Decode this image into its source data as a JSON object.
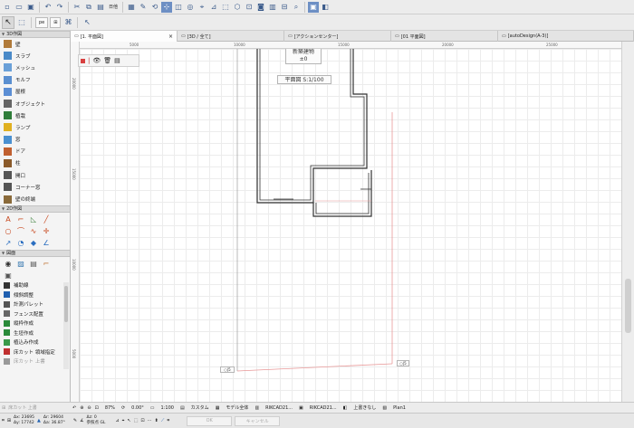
{
  "toolbar1": {
    "text_label": "日他",
    "icons": [
      "open-icon",
      "save-icon",
      "print-icon",
      "undo-icon",
      "redo-icon",
      "cut-icon",
      "copy-icon",
      "paste-icon"
    ]
  },
  "toolbar2": {
    "pen_dropdown": "pe",
    "layer_dropdown": "⊞",
    "arrow_tool": "↖"
  },
  "palette": {
    "group1_title": "3D作図",
    "tools": [
      {
        "label": "壁",
        "icon": "wall-icon",
        "color": "#b07a3a"
      },
      {
        "label": "スラブ",
        "icon": "slab-icon",
        "color": "#4a8ac8"
      },
      {
        "label": "メッシュ",
        "icon": "mesh-icon",
        "color": "#6aa0d8"
      },
      {
        "label": "モルフ",
        "icon": "morph-icon",
        "color": "#5a8fd0"
      },
      {
        "label": "屋根",
        "icon": "roof-icon",
        "color": "#5b8ed4"
      },
      {
        "label": "オブジェクト",
        "icon": "object-icon",
        "color": "#666666"
      },
      {
        "label": "植栽",
        "icon": "tree-icon",
        "color": "#2f7d3a"
      },
      {
        "label": "ランプ",
        "icon": "lamp-icon",
        "color": "#e0b020"
      },
      {
        "label": "窓",
        "icon": "window-icon",
        "color": "#4a90d0"
      },
      {
        "label": "ドア",
        "icon": "door-icon",
        "color": "#c06030"
      },
      {
        "label": "柱",
        "icon": "column-icon",
        "color": "#8a5a2a"
      },
      {
        "label": "開口",
        "icon": "opening-icon",
        "color": "#555555"
      },
      {
        "label": "コーナー窓",
        "icon": "corner-window-icon",
        "color": "#555555"
      },
      {
        "label": "壁の終端",
        "icon": "wall-end-icon",
        "color": "#8a6a3a"
      }
    ],
    "group2_title": "2D作図",
    "group3_title": "図面",
    "lower_tools": [
      {
        "label": "補助線",
        "icon": "guide-line-icon",
        "color": "#333333"
      },
      {
        "label": "傾斜調整",
        "icon": "slope-icon",
        "color": "#2060b0"
      },
      {
        "label": "計測パレット",
        "icon": "measure-icon",
        "color": "#555555"
      },
      {
        "label": "フェンス配置",
        "icon": "fence-icon",
        "color": "#666666"
      },
      {
        "label": "縦枠作成",
        "icon": "frame-icon",
        "color": "#2a8a3a"
      },
      {
        "label": "生垣作成",
        "icon": "hedge-icon",
        "color": "#2a8a3a"
      },
      {
        "label": "植込み作成",
        "icon": "planting-icon",
        "color": "#3a9a4a"
      },
      {
        "label": "床カット 領域指定",
        "icon": "floor-cut-icon",
        "color": "#c03030"
      },
      {
        "label": "床カット 上書",
        "icon": "floor-cut-override-icon",
        "color": "#999999"
      }
    ]
  },
  "tabs": [
    {
      "label": "[1. 平面図]",
      "active": true
    },
    {
      "label": "[3D / 全て]",
      "active": false
    },
    {
      "label": "[アクションセンター]",
      "active": false
    },
    {
      "label": "[01 平面図]",
      "active": false
    },
    {
      "label": "[autoDesign(A-3)]",
      "active": false
    }
  ],
  "ruler": {
    "top_ticks": [
      "5000",
      "10000",
      "15000",
      "20000",
      "25000"
    ],
    "left_ticks": [
      "20000",
      "15000",
      "10000",
      "5000"
    ]
  },
  "canvas": {
    "label_building": "新築建物",
    "label_level": "±0",
    "label_plan": "平面図 S:1/100",
    "marker_left": "○|5",
    "marker_right": "○|5"
  },
  "status1": {
    "zoom": "87%",
    "angle": "0.00°",
    "scale": "1:100",
    "custom": "カスタム",
    "model": "モデル全体",
    "rikcad1": "RIKCAD21...",
    "rikcad2": "RIKCAD21...",
    "override": "上書きなし",
    "plan": "Plan1"
  },
  "status0": {
    "ghost_label": "床カット 上書"
  },
  "status2": {
    "coord_x": "Δx: 23695",
    "coord_y": "Δy: 17742",
    "coord_r": "Δr: 29604",
    "coord_a": "Δa: 36.87°",
    "origin_label": "Δz: 0",
    "origin_sub": "参照点 GL",
    "ok": "OK",
    "cancel": "キャンセル"
  },
  "colors": {
    "accent": "#6d8fc4",
    "red_line": "#e89898",
    "wall_line": "#333333"
  }
}
